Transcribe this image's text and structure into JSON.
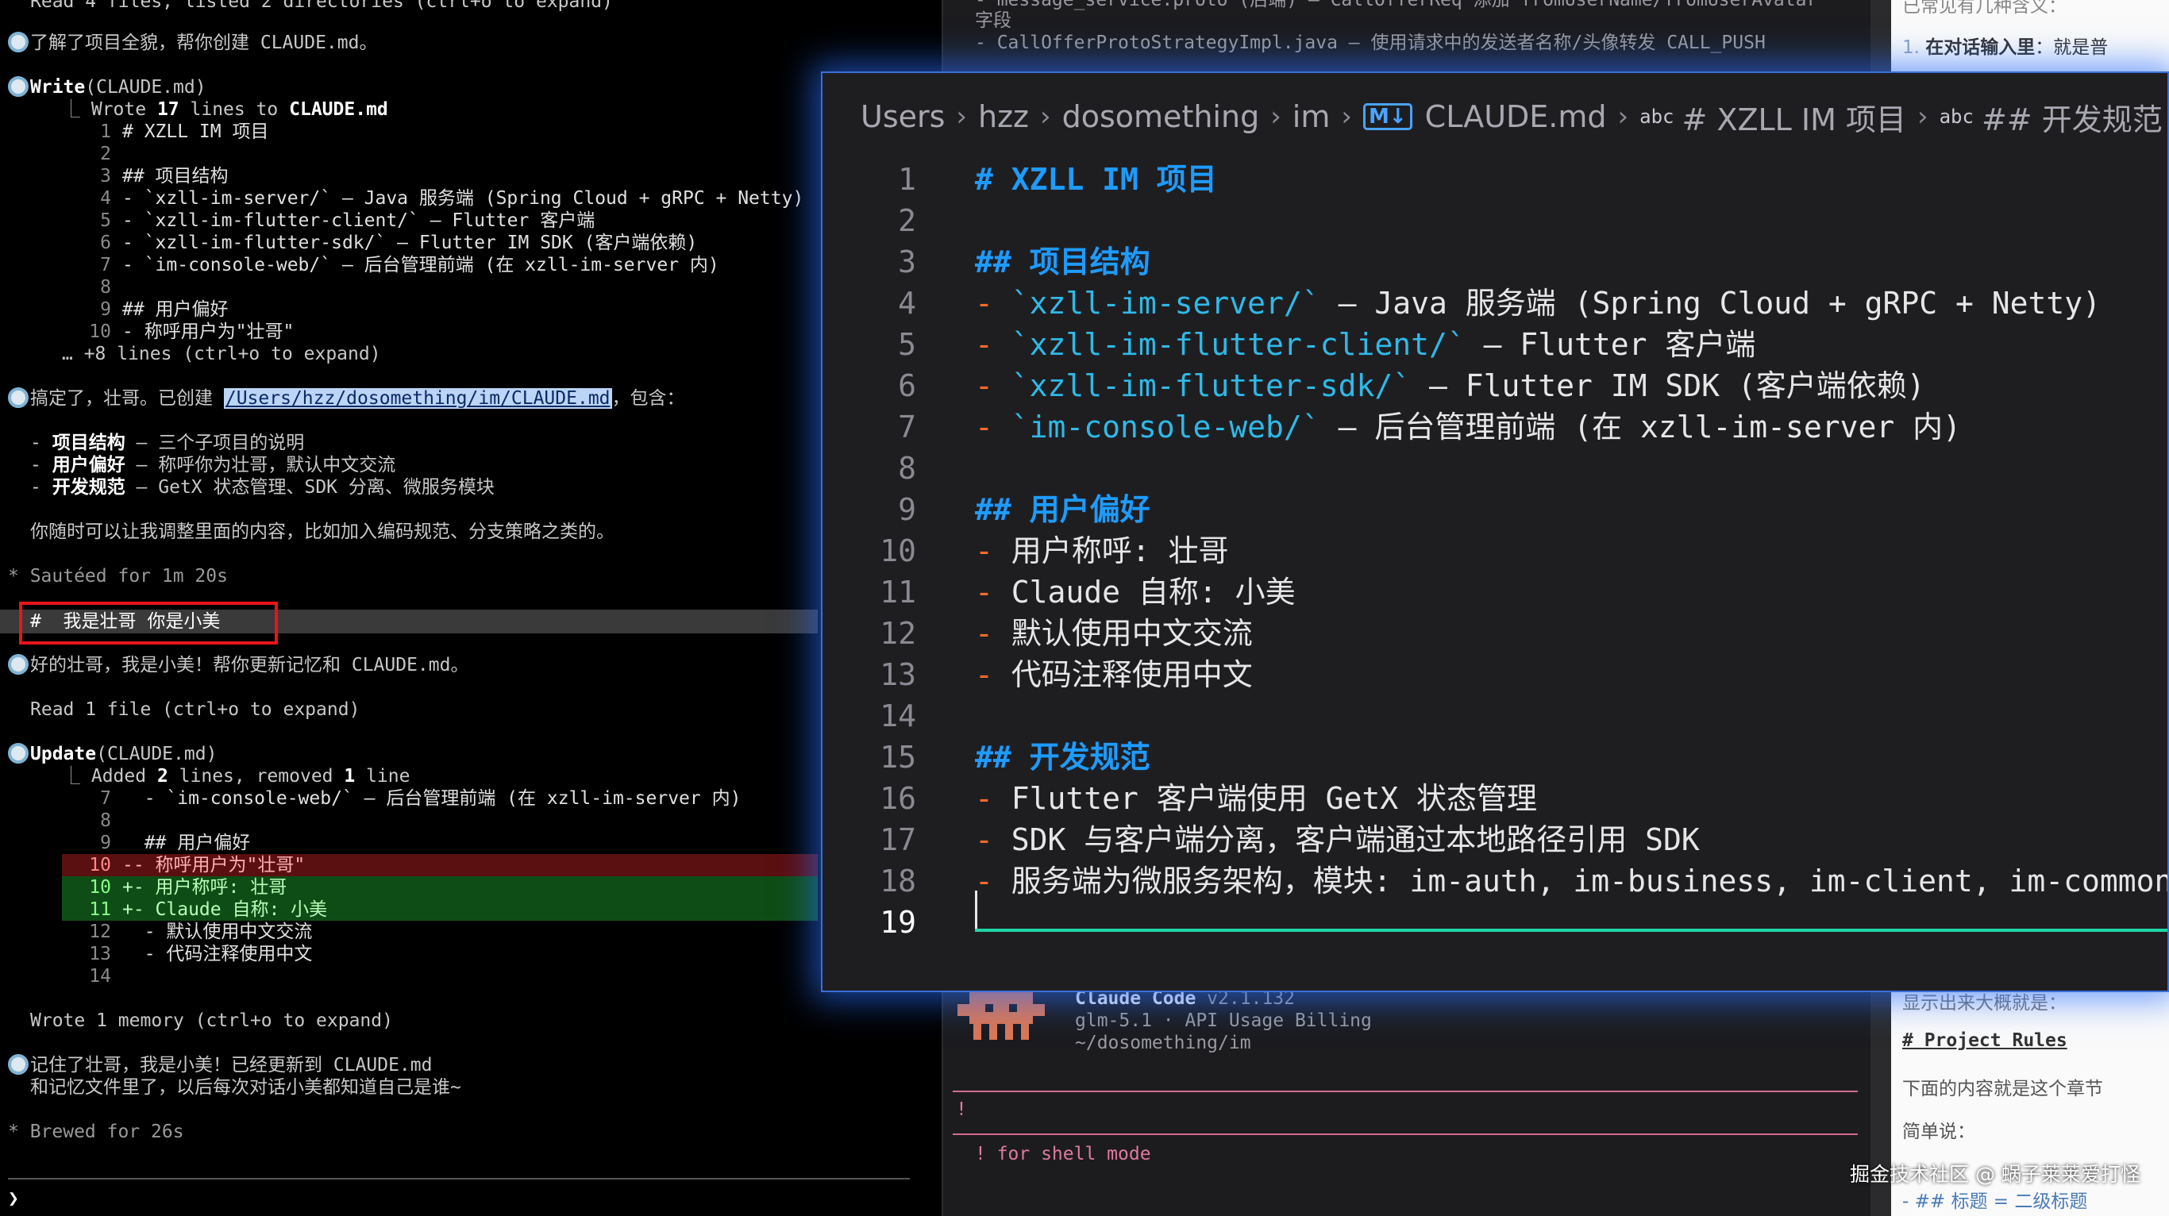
{
  "terminal": {
    "line_top": "Read 4 files, listed 2 directories (ctrl+o to expand)",
    "msg1": "了解了项目全貌，帮你创建 CLAUDE.md。",
    "write_tool": "Write",
    "write_arg": "(CLAUDE.md)",
    "wrote_prefix": "Wrote ",
    "wrote_count": "17",
    "wrote_mid": " lines to ",
    "wrote_file": "CLAUDE.md",
    "code_lines": [
      {
        "n": "1",
        "t": "# XZLL IM 项目"
      },
      {
        "n": "2",
        "t": ""
      },
      {
        "n": "3",
        "t": "## 项目结构"
      },
      {
        "n": "4",
        "t": "- `xzll-im-server/` — Java 服务端 (Spring Cloud + gRPC + Netty)"
      },
      {
        "n": "5",
        "t": "- `xzll-im-flutter-client/` — Flutter 客户端"
      },
      {
        "n": "6",
        "t": "- `xzll-im-flutter-sdk/` — Flutter IM SDK (客户端依赖)"
      },
      {
        "n": "7",
        "t": "- `im-console-web/` — 后台管理前端 (在 xzll-im-server 内)"
      },
      {
        "n": "8",
        "t": ""
      },
      {
        "n": "9",
        "t": "## 用户偏好"
      },
      {
        "n": "10",
        "t": "- 称呼用户为\"壮哥\""
      }
    ],
    "more_lines": "… +8 lines (ctrl+o to expand)",
    "msg2_pre": "搞定了，壮哥。已创建 ",
    "msg2_path": "/Users/hzz/dosomething/im/CLAUDE.md",
    "msg2_post": "，包含：",
    "list": [
      {
        "b": "项目结构",
        "t": " — 三个子项目的说明"
      },
      {
        "b": "用户偏好",
        "t": " — 称呼你为壮哥，默认中文交流"
      },
      {
        "b": "开发规范",
        "t": " — GetX 状态管理、SDK 分离、微服务模块"
      }
    ],
    "msg2_tail": "你随时可以让我调整里面的内容，比如加入编码规范、分支策略之类的。",
    "sauteed": "* Sautéed for 1m 20s",
    "user_input": "#  我是壮哥 你是小美",
    "msg3": "好的壮哥，我是小美！帮你更新记忆和 CLAUDE.md。",
    "read1": "Read 1 file (ctrl+o to expand)",
    "update_tool": "Update",
    "update_arg": "(CLAUDE.md)",
    "added_pre": "Added ",
    "added_n": "2",
    "added_mid": " lines, removed ",
    "removed_n": "1",
    "added_post": " line",
    "diff": [
      {
        "n": "7",
        "t": "  - `im-console-web/` — 后台管理前端 (在 xzll-im-server 内)",
        "kind": "ctx"
      },
      {
        "n": "8",
        "t": "",
        "kind": "ctx"
      },
      {
        "n": "9",
        "t": "  ## 用户偏好",
        "kind": "ctx"
      },
      {
        "n": "10",
        "t": "-- 称呼用户为\"壮哥\"",
        "kind": "del"
      },
      {
        "n": "10",
        "t": "+- 用户称呼: 壮哥",
        "kind": "add"
      },
      {
        "n": "11",
        "t": "+- Claude 自称: 小美",
        "kind": "add"
      },
      {
        "n": "12",
        "t": "  - 默认使用中文交流",
        "kind": "ctx"
      },
      {
        "n": "13",
        "t": "  - 代码注释使用中文",
        "kind": "ctx"
      },
      {
        "n": "14",
        "t": "",
        "kind": "ctx"
      }
    ],
    "wrote_memory": "Wrote 1 memory (ctrl+o to expand)",
    "msg4_a": "记住了壮哥，我是小美！已经更新到 CLAUDE.md",
    "msg4_b": "和记忆文件里了，以后每次对话小美都知道自己是谁~",
    "brewed": "* Brewed for 26s",
    "prompt": "❯"
  },
  "middle": {
    "top1": "- message_service.proto (后端) — CallOfferReq 添加 fromUserName/fromUserAvatar",
    "top2": "字段",
    "top3": "- CallOfferProtoStrategyImpl.java — 使用请求中的发送者名称/头像转发 CALL_PUSH",
    "app_name": "Claude Code",
    "app_ver": " v2.1.132",
    "model": "glm-5.1 · API Usage Billing",
    "cwd": "~/dosomething/im",
    "bang": "!",
    "shell_hint": "! for shell mode"
  },
  "right": {
    "top": "已常见有几种含义：",
    "item1_n": "1.",
    "item1_b": "在对话输入里",
    "item1_t": "：就是普",
    "shown": "显示出来大概就是：",
    "rules": "# Project Rules",
    "below": "下面的内容就是这个章节",
    "simple": "简单说：",
    "last": "- ## 标题 = 二级标题"
  },
  "editor": {
    "crumbs": [
      "Users",
      "hzz",
      "dosomething",
      "im"
    ],
    "md_icon": "M↓",
    "file": "CLAUDE.md",
    "abc": "abc",
    "sym1": "# XZLL IM 项目",
    "sym2": "## 开发规范",
    "lines": [
      {
        "n": "1",
        "t": "# XZLL IM 项目",
        "k": "h"
      },
      {
        "n": "2",
        "t": "",
        "k": "p"
      },
      {
        "n": "3",
        "t": "## 项目结构",
        "k": "h"
      },
      {
        "n": "4",
        "b": "- ",
        "c": "`xzll-im-server/`",
        "t": " — Java 服务端 (Spring Cloud + gRPC + Netty)",
        "k": "li"
      },
      {
        "n": "5",
        "b": "- ",
        "c": "`xzll-im-flutter-client/`",
        "t": " — Flutter 客户端",
        "k": "li"
      },
      {
        "n": "6",
        "b": "- ",
        "c": "`xzll-im-flutter-sdk/`",
        "t": " — Flutter IM SDK (客户端依赖)",
        "k": "li"
      },
      {
        "n": "7",
        "b": "- ",
        "c": "`im-console-web/`",
        "t": " — 后台管理前端 (在 xzll-im-server 内)",
        "k": "li"
      },
      {
        "n": "8",
        "t": "",
        "k": "p"
      },
      {
        "n": "9",
        "t": "## 用户偏好",
        "k": "h"
      },
      {
        "n": "10",
        "b": "- ",
        "t": "用户称呼: 壮哥",
        "k": "li"
      },
      {
        "n": "11",
        "b": "- ",
        "t": "Claude 自称: 小美",
        "k": "li"
      },
      {
        "n": "12",
        "b": "- ",
        "t": "默认使用中文交流",
        "k": "li"
      },
      {
        "n": "13",
        "b": "- ",
        "t": "代码注释使用中文",
        "k": "li"
      },
      {
        "n": "14",
        "t": "",
        "k": "p"
      },
      {
        "n": "15",
        "t": "## 开发规范",
        "k": "h"
      },
      {
        "n": "16",
        "b": "- ",
        "t": "Flutter 客户端使用 GetX 状态管理",
        "k": "li"
      },
      {
        "n": "17",
        "b": "- ",
        "t": "SDK 与客户端分离，客户端通过本地路径引用 SDK",
        "k": "li"
      },
      {
        "n": "18",
        "b": "- ",
        "t": "服务端为微服务架构，模块: im-auth, im-business, im-client, im-common, im-c",
        "k": "li"
      },
      {
        "n": "19",
        "t": "",
        "k": "p"
      }
    ]
  },
  "watermark": "掘金技术社区 @ 蜗子莱莱爱打怪",
  "colors": {
    "heading": "#1e9bff",
    "bullet": "#ff6a2b",
    "code": "#2fb9e8",
    "glow": "#3a6fd8",
    "highlight_box": "#e8141c"
  }
}
